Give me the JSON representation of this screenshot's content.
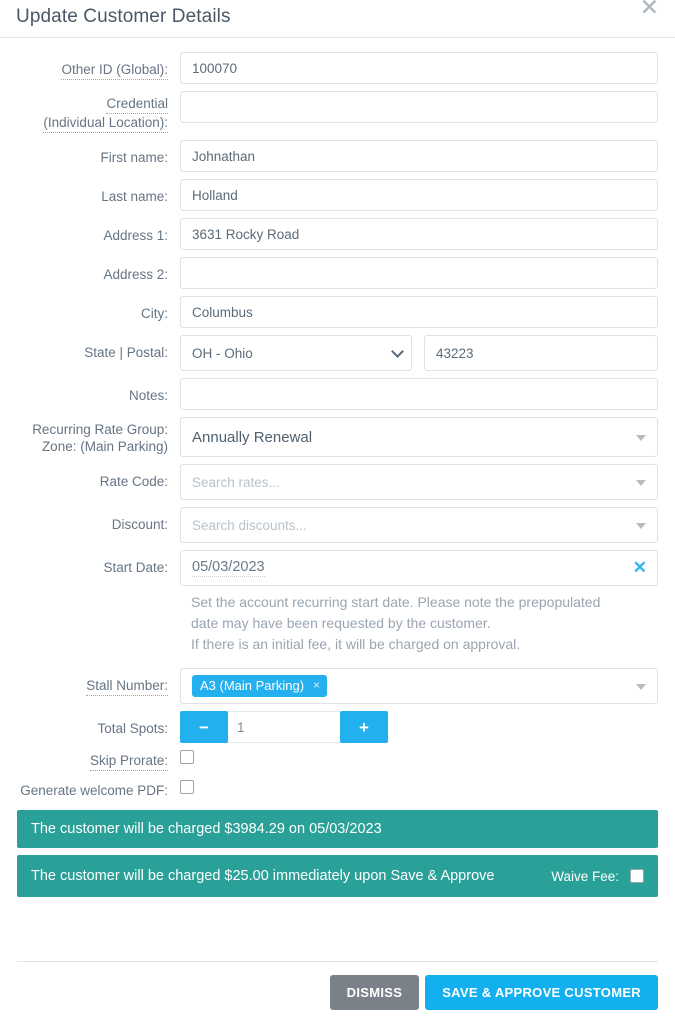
{
  "dialog": {
    "title": "Update Customer Details",
    "close_icon": "close-icon"
  },
  "fields": {
    "other_id": {
      "label": "Other ID (Global):",
      "value": "100070"
    },
    "credential": {
      "label_line1": "Credential",
      "label_line2": "(Individual Location):",
      "value": ""
    },
    "first_name": {
      "label": "First name:",
      "value": "Johnathan"
    },
    "last_name": {
      "label": "Last name:",
      "value": "Holland"
    },
    "address1": {
      "label": "Address 1:",
      "value": "3631 Rocky Road"
    },
    "address2": {
      "label": "Address 2:",
      "value": ""
    },
    "city": {
      "label": "City:",
      "value": "Columbus"
    },
    "state_postal": {
      "label": "State | Postal:",
      "state_value": "OH - Ohio",
      "postal_value": "43223"
    },
    "notes": {
      "label": "Notes:",
      "value": ""
    },
    "rate_group": {
      "label_line1": "Recurring Rate Group:",
      "label_line2": "Zone: (Main Parking)",
      "value": "Annually Renewal"
    },
    "rate_code": {
      "label": "Rate Code:",
      "placeholder": "Search rates..."
    },
    "discount": {
      "label": "Discount:",
      "placeholder": "Search discounts..."
    },
    "start_date": {
      "label": "Start Date:",
      "value": "05/03/2023",
      "clear_icon": "clear-icon",
      "help_line1": "Set the account recurring start date. Please note the prepopulated",
      "help_line2": "date may have been requested by the customer.",
      "help_line3": "If there is an initial fee, it will be charged on approval."
    },
    "stall_number": {
      "label": "Stall Number:",
      "chip": "A3 (Main Parking)",
      "chip_remove": "×"
    },
    "total_spots": {
      "label": "Total Spots:",
      "value": "1",
      "decrement": "−",
      "increment": "+"
    },
    "skip_prorate": {
      "label": "Skip Prorate:",
      "checked": false
    },
    "generate_pdf": {
      "label": "Generate welcome PDF:",
      "checked": false
    }
  },
  "banners": {
    "recurring_charge": "The customer will be charged $3984.29 on 05/03/2023",
    "immediate_charge": "The customer will be charged $25.00 immediately upon Save & Approve",
    "waive_fee_label": "Waive Fee:"
  },
  "footer": {
    "dismiss": "DISMISS",
    "save": "SAVE & APPROVE CUSTOMER"
  },
  "colors": {
    "primary_blue": "#13b0f0",
    "banner_teal": "#2aa198",
    "dismiss_gray": "#7a8188"
  }
}
